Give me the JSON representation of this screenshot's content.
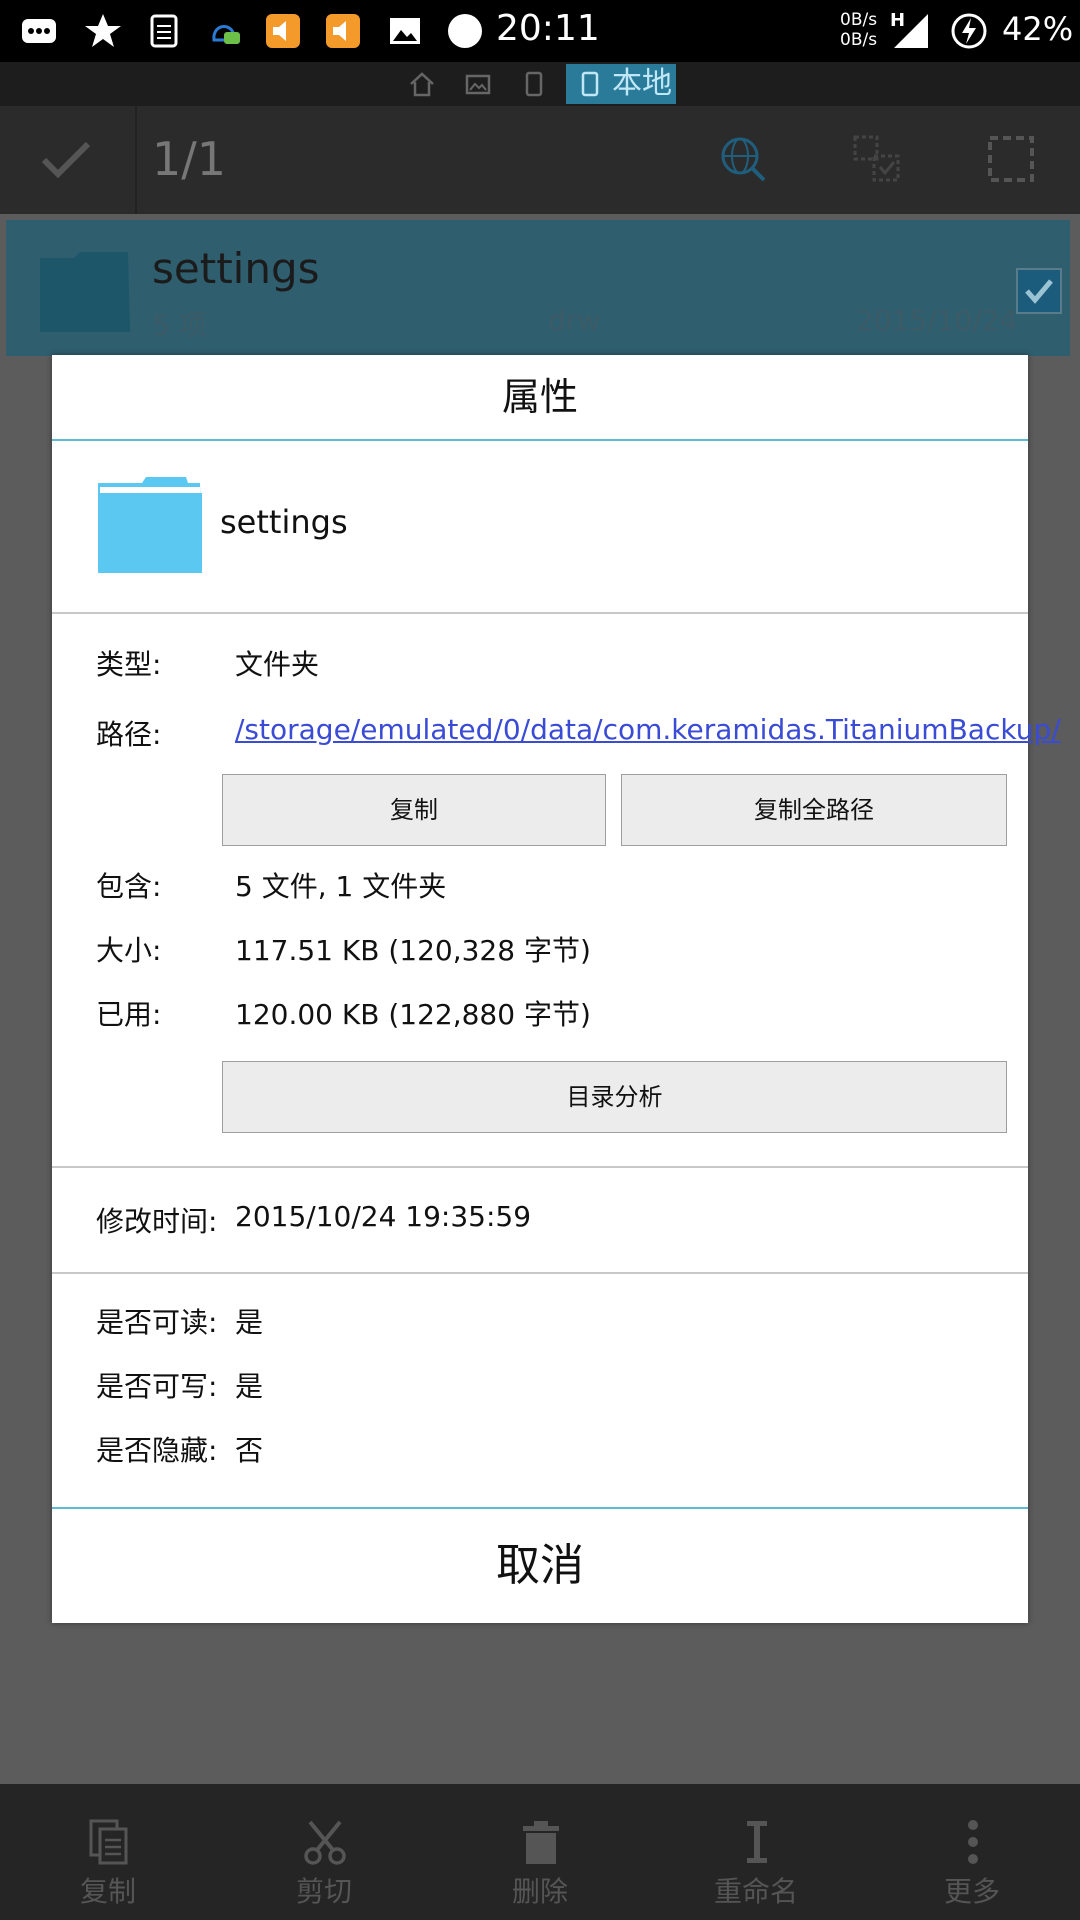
{
  "status_bar": {
    "time": "20:11",
    "net_up": "0B/s",
    "net_down": "0B/s",
    "network_type": "H",
    "battery": "42%"
  },
  "path_bar": {
    "local_label": "本地"
  },
  "action_bar": {
    "selection_count": "1/1"
  },
  "list_row": {
    "name": "settings",
    "item_count": "5 项",
    "permissions": "drw",
    "date": "2015/10/24"
  },
  "dialog": {
    "title": "属性",
    "name": "settings",
    "type_label": "类型:",
    "type_value": "文件夹",
    "path_label": "路径:",
    "path_value": "/storage/emulated/0/data/com.keramidas.TitaniumBackup/",
    "copy_button": "复制",
    "copy_full_path_button": "复制全路径",
    "contains_label": "包含:",
    "contains_value": "5 文件, 1 文件夹",
    "size_label": "大小:",
    "size_value": "117.51 KB (120,328 字节)",
    "used_label": "已用:",
    "used_value": "120.00 KB (122,880 字节)",
    "analyze_button": "目录分析",
    "modified_label": "修改时间:",
    "modified_value": "2015/10/24 19:35:59",
    "readable_label": "是否可读:",
    "readable_value": "是",
    "writable_label": "是否可写:",
    "writable_value": "是",
    "hidden_label": "是否隐藏:",
    "hidden_value": "否",
    "cancel_button": "取消"
  },
  "bottom_bar": {
    "items": [
      {
        "label": "复制",
        "icon": "copy-icon"
      },
      {
        "label": "剪切",
        "icon": "cut-icon"
      },
      {
        "label": "删除",
        "icon": "delete-icon"
      },
      {
        "label": "重命名",
        "icon": "rename-icon"
      },
      {
        "label": "更多",
        "icon": "more-icon"
      }
    ]
  },
  "colors": {
    "accent": "#5bbcd4",
    "folder": "#5ac8f0",
    "link": "#3a4bd6"
  }
}
